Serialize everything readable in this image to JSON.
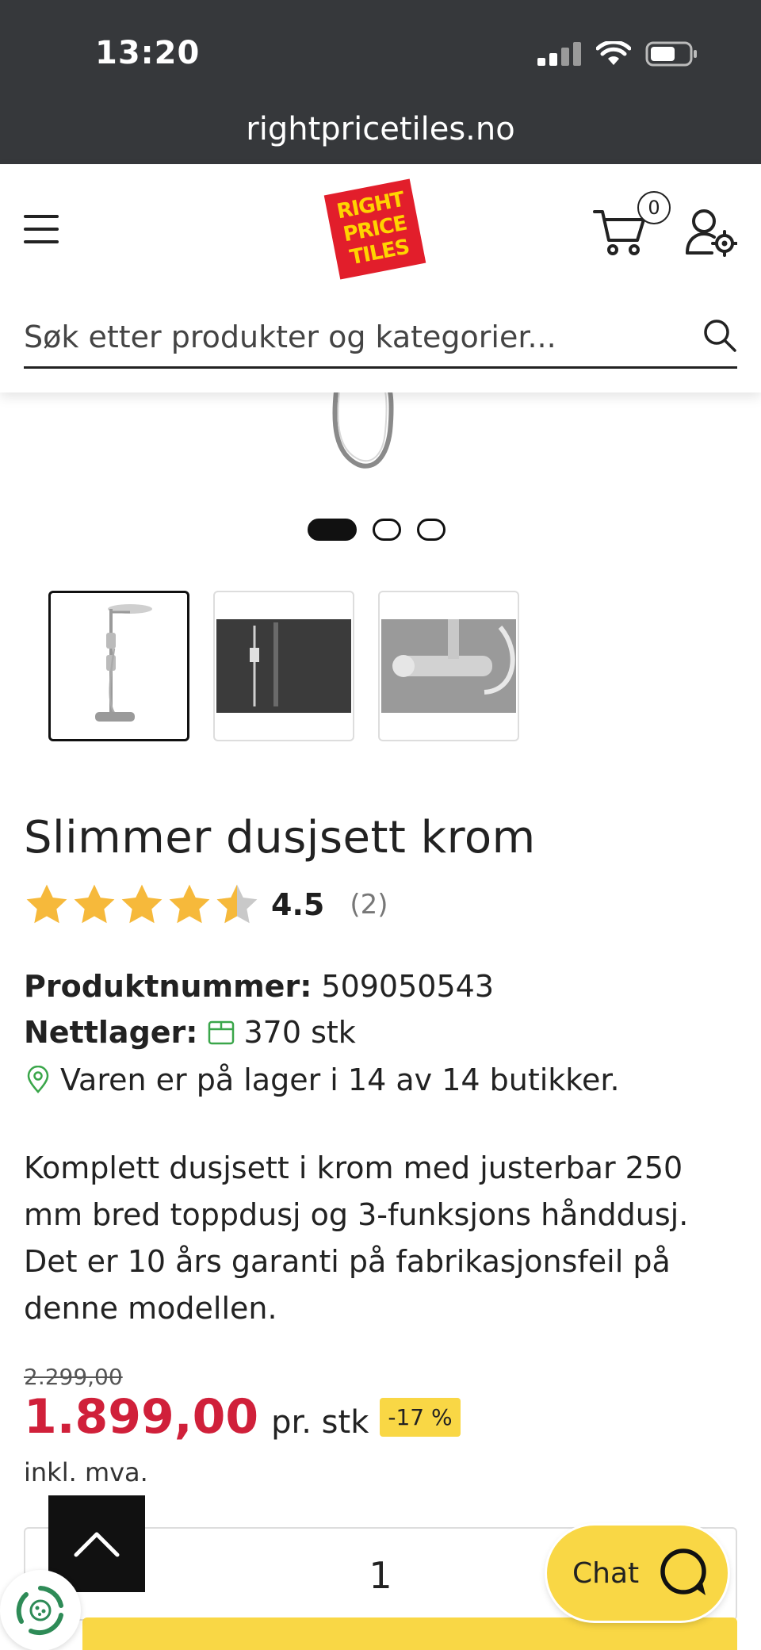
{
  "status_bar": {
    "time": "13:20",
    "url": "rightpricetiles.no"
  },
  "header": {
    "logo_lines": [
      "RIGHT",
      "PRICE",
      "TILES"
    ],
    "cart_count": "0",
    "search_placeholder": "Søk etter produkter og kategorier..."
  },
  "gallery": {
    "total_slides": 3,
    "active_slide": 1,
    "thumbnails": 3
  },
  "product": {
    "title": "Slimmer dusjsett krom",
    "rating": {
      "value": "4.5",
      "count": "(2)",
      "stars": 4.5,
      "max_stars": 5
    },
    "product_number_label": "Produktnummer:",
    "product_number": "509050543",
    "stock_label": "Nettlager:",
    "stock_value": "370 stk",
    "store_availability": "Varen er på lager i 14 av 14 butikker.",
    "description": "Komplett dusjsett i krom med justerbar 250 mm bred toppdusj og 3-funksjons hånddusj. Det er 10 års garanti på fabrikasjonsfeil på denne modellen.",
    "old_price": "2.299,00",
    "price": "1.899,00",
    "unit": "pr. stk",
    "discount": "-17 %",
    "vat_note": "inkl. mva.",
    "quantity": "1"
  },
  "chat": {
    "label": "Chat"
  },
  "colors": {
    "accent_yellow": "#f9d745",
    "price_red": "#d0203a",
    "stock_green": "#3aa64a",
    "star": "#f6b93b"
  }
}
